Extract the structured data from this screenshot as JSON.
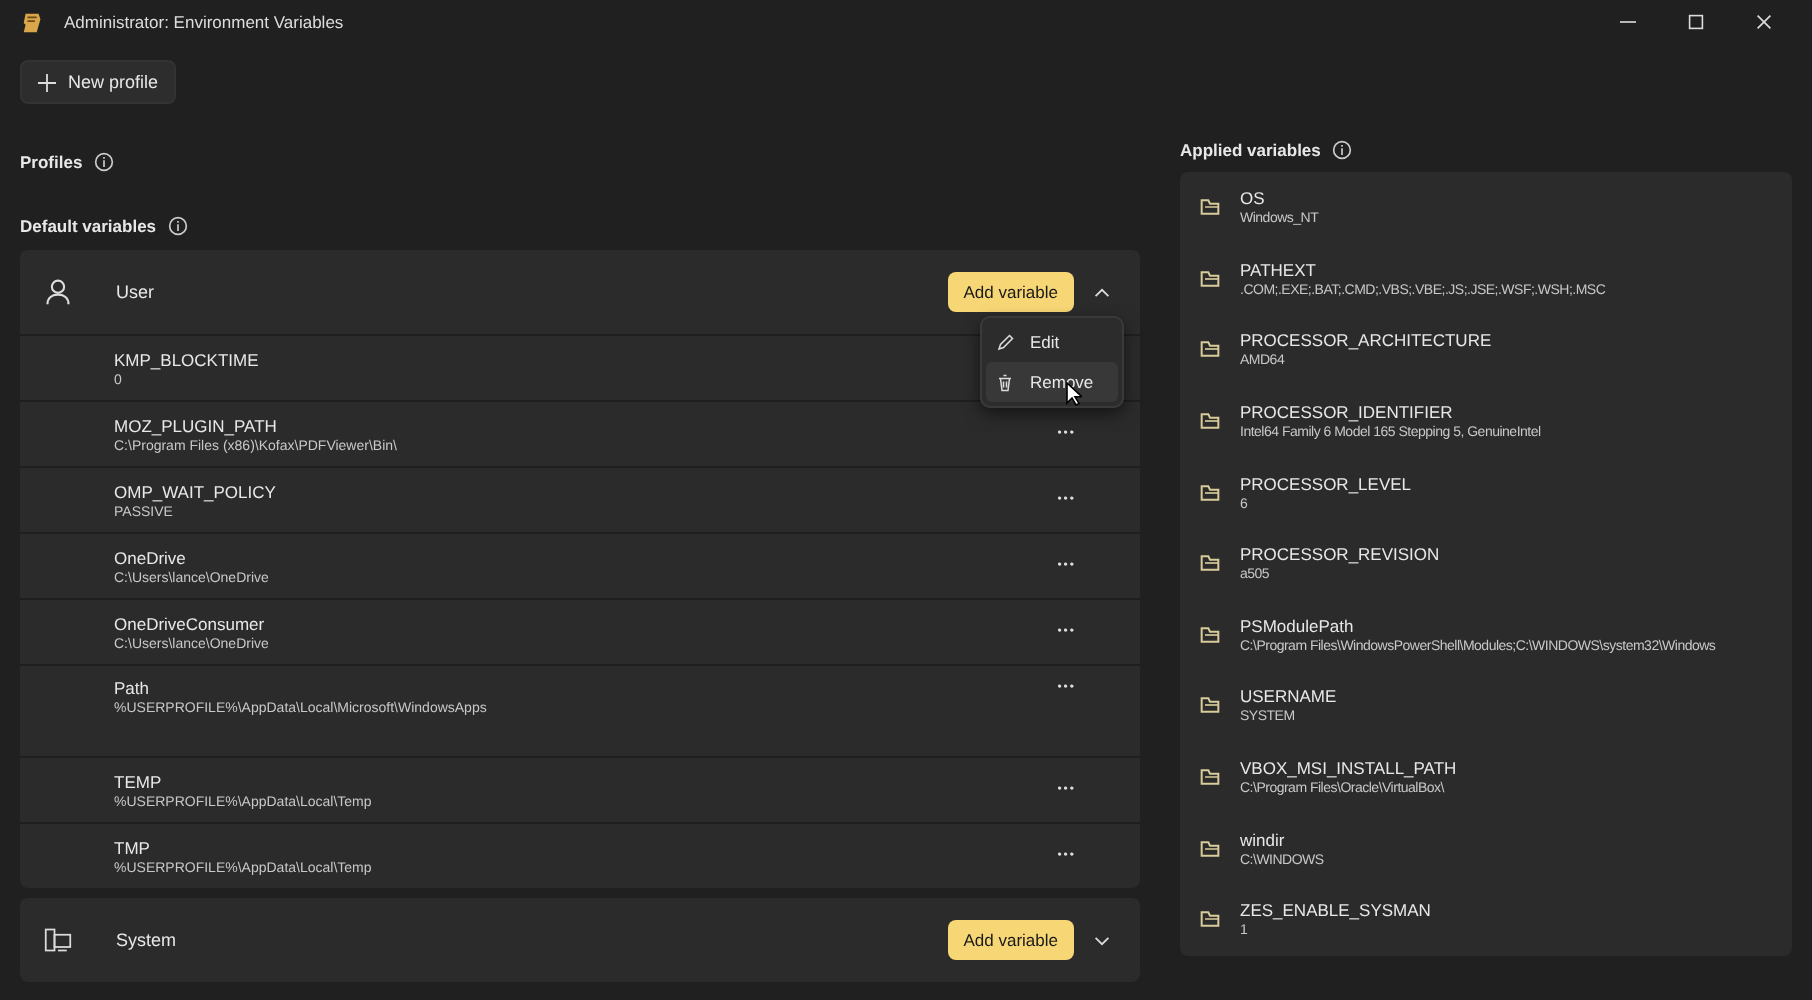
{
  "window": {
    "title": "Administrator: Environment Variables"
  },
  "new_profile_button": {
    "label": "New profile"
  },
  "profiles_heading": {
    "label": "Profiles"
  },
  "default_heading": {
    "label": "Default variables"
  },
  "sections": [
    {
      "kind": "user",
      "name": "User",
      "add_label": "Add variable",
      "expanded": true,
      "variables": [
        {
          "name": "KMP_BLOCKTIME",
          "value": "0",
          "tall": false,
          "menu_open": true
        },
        {
          "name": "MOZ_PLUGIN_PATH",
          "value": "C:\\Program Files (x86)\\Kofax\\PDFViewer\\Bin\\",
          "tall": false,
          "menu_open": false,
          "more": "•••"
        },
        {
          "name": "OMP_WAIT_POLICY",
          "value": "PASSIVE",
          "tall": false,
          "menu_open": false,
          "more": "•••"
        },
        {
          "name": "OneDrive",
          "value": "C:\\Users\\lance\\OneDrive",
          "tall": false,
          "menu_open": false,
          "more": "•••"
        },
        {
          "name": "OneDriveConsumer",
          "value": "C:\\Users\\lance\\OneDrive",
          "tall": false,
          "menu_open": false,
          "more": "•••"
        },
        {
          "name": "Path",
          "value": "%USERPROFILE%\\AppData\\Local\\Microsoft\\WindowsApps",
          "tall": true,
          "menu_open": false,
          "more": "•••"
        },
        {
          "name": "TEMP",
          "value": "%USERPROFILE%\\AppData\\Local\\Temp",
          "tall": false,
          "menu_open": false,
          "more": "•••"
        },
        {
          "name": "TMP",
          "value": "%USERPROFILE%\\AppData\\Local\\Temp",
          "tall": false,
          "menu_open": false,
          "more": "•••"
        }
      ]
    },
    {
      "kind": "system",
      "name": "System",
      "add_label": "Add variable",
      "expanded": false
    }
  ],
  "context_menu": {
    "items": [
      {
        "kind": "edit",
        "label": "Edit"
      },
      {
        "kind": "remove",
        "label": "Remove"
      }
    ]
  },
  "applied": {
    "heading": "Applied variables",
    "variables": [
      {
        "name": "OS",
        "value": "Windows_NT"
      },
      {
        "name": "PATHEXT",
        "value": ".COM;.EXE;.BAT;.CMD;.VBS;.VBE;.JS;.JSE;.WSF;.WSH;.MSC"
      },
      {
        "name": "PROCESSOR_ARCHITECTURE",
        "value": "AMD64"
      },
      {
        "name": "PROCESSOR_IDENTIFIER",
        "value": "Intel64 Family 6 Model 165 Stepping 5, GenuineIntel"
      },
      {
        "name": "PROCESSOR_LEVEL",
        "value": "6"
      },
      {
        "name": "PROCESSOR_REVISION",
        "value": "a505"
      },
      {
        "name": "PSModulePath",
        "value": "C:\\Program Files\\WindowsPowerShell\\Modules;C:\\WINDOWS\\system32\\Windows"
      },
      {
        "name": "USERNAME",
        "value": "SYSTEM"
      },
      {
        "name": "VBOX_MSI_INSTALL_PATH",
        "value": "C:\\Program Files\\Oracle\\VirtualBox\\"
      },
      {
        "name": "windir",
        "value": "C:\\WINDOWS"
      },
      {
        "name": "ZES_ENABLE_SYSMAN",
        "value": "1"
      }
    ]
  }
}
